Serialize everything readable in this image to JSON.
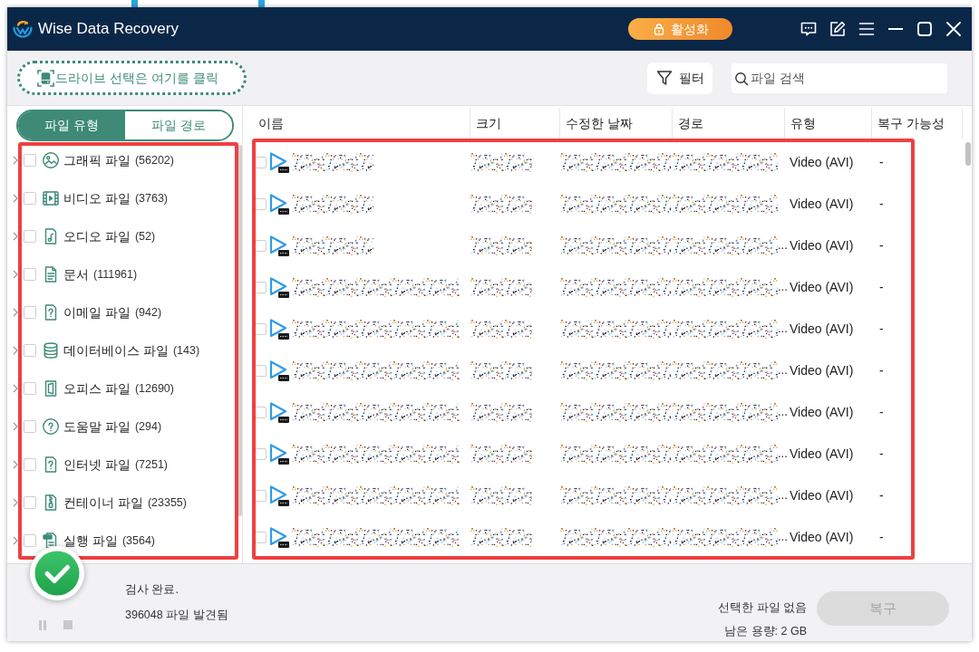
{
  "window": {
    "title": "Wise Data Recovery",
    "activate_button": "활성화"
  },
  "toolbar": {
    "drive_select": "드라이브 선택은 여기를 클릭",
    "filter_button": "필터",
    "search": {
      "placeholder": "파일 검색"
    }
  },
  "sidebar": {
    "tabs": [
      {
        "label": "파일 유형",
        "selected": true
      },
      {
        "label": "파일 경로",
        "selected": false
      }
    ],
    "items": [
      {
        "label": "그래픽 파일",
        "count": "(56202)",
        "checked": false,
        "expanded": false
      },
      {
        "label": "비디오 파일",
        "count": "(3763)",
        "checked": false,
        "expanded": false
      },
      {
        "label": "오디오 파일",
        "count": "(52)",
        "checked": false,
        "expanded": false
      },
      {
        "label": "문서",
        "count": "(111961)",
        "checked": false,
        "expanded": false
      },
      {
        "label": "이메일 파일",
        "count": "(942)",
        "checked": false,
        "expanded": false
      },
      {
        "label": "데이터베이스 파일",
        "count": "(143)",
        "checked": false,
        "expanded": false
      },
      {
        "label": "오피스 파일",
        "count": "(12690)",
        "checked": false,
        "expanded": false
      },
      {
        "label": "도움말 파일",
        "count": "(294)",
        "checked": false,
        "expanded": false
      },
      {
        "label": "인터넷 파일",
        "count": "(7251)",
        "checked": false,
        "expanded": false
      },
      {
        "label": "컨테이너 파일",
        "count": "(23355)",
        "checked": false,
        "expanded": false
      },
      {
        "label": "실행 파일",
        "count": "(3564)",
        "checked": false,
        "expanded": false
      }
    ]
  },
  "table": {
    "columns": [
      "이름",
      "크기",
      "수정한 날짜",
      "경로",
      "유형",
      "복구 가능성"
    ],
    "rows": [
      {
        "kind": "short",
        "checked": false,
        "type": "Video (AVI)",
        "recoverability": "-"
      },
      {
        "kind": "short",
        "checked": false,
        "type": "Video (AVI)",
        "recoverability": "-"
      },
      {
        "kind": "short",
        "checked": false,
        "path_suffix": "...",
        "type": "Video (AVI)",
        "recoverability": "-"
      },
      {
        "kind": "long",
        "checked": false,
        "path_suffix": "...",
        "type": "Video (AVI)",
        "recoverability": "-"
      },
      {
        "kind": "long",
        "checked": false,
        "path_suffix": "...",
        "type": "Video (AVI)",
        "recoverability": "-"
      },
      {
        "kind": "long",
        "checked": false,
        "path_suffix": "...",
        "type": "Video (AVI)",
        "recoverability": "-"
      },
      {
        "kind": "long",
        "checked": false,
        "path_suffix": "...",
        "type": "Video (AVI)",
        "recoverability": "-"
      },
      {
        "kind": "long",
        "checked": false,
        "path_suffix": "...",
        "type": "Video (AVI)",
        "recoverability": "-"
      },
      {
        "kind": "long",
        "checked": false,
        "path_suffix": "...",
        "type": "Video (AVI)",
        "recoverability": "-"
      },
      {
        "kind": "long",
        "checked": false,
        "path_suffix": "...",
        "type": "Video (AVI)",
        "recoverability": "-"
      }
    ]
  },
  "status_bar": {
    "status": "검사 완료.",
    "found": "396048 파일 발견됨",
    "selection": "선택한 파일 없음",
    "free_space": "남은 용량: 2 GB",
    "recover_button": {
      "label": "복구",
      "disabled": true
    }
  }
}
